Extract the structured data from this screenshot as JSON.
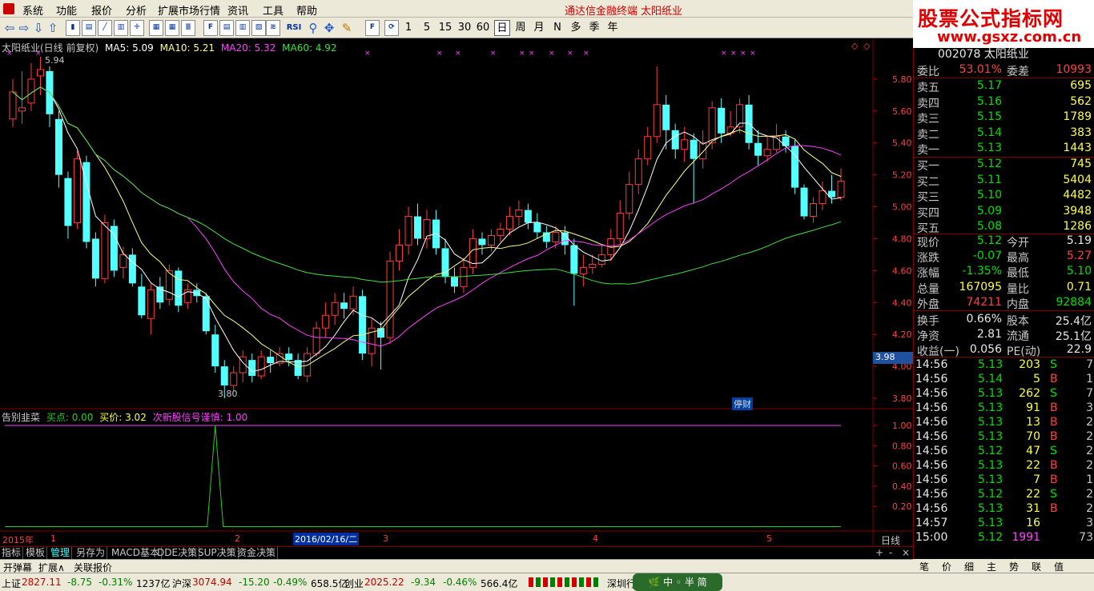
{
  "menu": {
    "items": [
      "系统",
      "功能",
      "报价",
      "分析",
      "扩展市场行情",
      "资讯",
      "工具",
      "帮助"
    ],
    "promo1": "通达信金融终端",
    "promo2": "太阳纸业"
  },
  "watermark": {
    "line1": "股票公式指标网",
    "line2": "www.gsxz.com.cn"
  },
  "toolbar": {
    "box_icons": [
      "RSI"
    ],
    "periods": [
      "1",
      "5",
      "15",
      "30",
      "60",
      "日",
      "周",
      "月",
      "N",
      "多",
      "季",
      "年"
    ],
    "active_period": "日"
  },
  "chart_header": {
    "title": "太阳纸业(日线 前复权)",
    "ma5": "MA5: 5.09",
    "ma10": "MA10: 5.21",
    "ma20": "MA20: 5.32",
    "ma60": "MA60: 4.92",
    "high_mark": "5.94",
    "low_mark": "3.80",
    "cursor_price": "3.98",
    "badge": "停财"
  },
  "indicator_header": {
    "name": "告别韭菜",
    "buy_point": "买点: 0.00",
    "buy_price": "买价: 3.02",
    "signal": "次新股信号谨慎: 1.00"
  },
  "x_axis": {
    "labels": [
      "2015年",
      "1",
      "2016/02/16/二",
      "3",
      "4",
      "5"
    ],
    "period_label": "日线"
  },
  "chart_data": [
    {
      "type": "candlestick",
      "title": "太阳纸业(日线 前复权)",
      "y_ticks": [
        5.8,
        5.6,
        5.4,
        5.2,
        5.0,
        4.8,
        4.6,
        4.4,
        4.2,
        4.0,
        3.8
      ],
      "ylim": [
        3.76,
        5.98
      ],
      "candles": [
        [
          5.55,
          5.72,
          5.8,
          5.5
        ],
        [
          5.6,
          5.62,
          5.85,
          5.52
        ],
        [
          5.65,
          5.8,
          5.9,
          5.6
        ],
        [
          5.82,
          5.86,
          5.94,
          5.7
        ],
        [
          5.85,
          5.58,
          5.88,
          5.5
        ],
        [
          5.55,
          5.2,
          5.6,
          5.12
        ],
        [
          5.18,
          4.88,
          5.22,
          4.8
        ],
        [
          4.9,
          5.3,
          5.35,
          4.86
        ],
        [
          5.28,
          4.78,
          5.32,
          4.74
        ],
        [
          4.8,
          4.55,
          4.84,
          4.5
        ],
        [
          4.55,
          4.9,
          4.95,
          4.52
        ],
        [
          4.88,
          4.6,
          4.92,
          4.56
        ],
        [
          4.62,
          4.7,
          4.75,
          4.55
        ],
        [
          4.7,
          4.52,
          4.74,
          4.5
        ],
        [
          4.5,
          4.32,
          4.58,
          4.3
        ],
        [
          4.3,
          4.48,
          4.52,
          4.2
        ],
        [
          4.5,
          4.4,
          4.56,
          4.36
        ],
        [
          4.42,
          4.6,
          4.64,
          4.38
        ],
        [
          4.6,
          4.38,
          4.62,
          4.34
        ],
        [
          4.4,
          4.48,
          4.52,
          4.36
        ],
        [
          4.48,
          4.44,
          4.52,
          4.4
        ],
        [
          4.44,
          4.22,
          4.46,
          4.2
        ],
        [
          4.2,
          4.0,
          4.26,
          3.96
        ],
        [
          4.0,
          3.88,
          4.04,
          3.8
        ],
        [
          3.88,
          3.96,
          4.0,
          3.84
        ],
        [
          3.96,
          4.06,
          4.1,
          3.9
        ],
        [
          4.04,
          3.94,
          4.08,
          3.9
        ],
        [
          3.94,
          4.06,
          4.1,
          3.92
        ],
        [
          4.06,
          4.02,
          4.1,
          3.96
        ],
        [
          4.02,
          4.08,
          4.12,
          4.0
        ],
        [
          4.08,
          4.04,
          4.12,
          4.0
        ],
        [
          4.04,
          3.94,
          4.08,
          3.92
        ],
        [
          3.94,
          4.08,
          4.12,
          3.9
        ],
        [
          4.08,
          4.24,
          4.28,
          4.06
        ],
        [
          4.24,
          4.32,
          4.4,
          4.18
        ],
        [
          4.32,
          4.4,
          4.46,
          4.26
        ],
        [
          4.4,
          4.36,
          4.46,
          4.3
        ],
        [
          4.36,
          4.44,
          4.5,
          4.32
        ],
        [
          4.44,
          4.08,
          4.48,
          4.04
        ],
        [
          4.08,
          4.24,
          4.3,
          4.0
        ],
        [
          4.24,
          4.18,
          4.28,
          3.98
        ],
        [
          4.18,
          4.66,
          4.72,
          4.14
        ],
        [
          4.66,
          4.76,
          4.86,
          4.6
        ],
        [
          4.76,
          4.94,
          5.0,
          4.7
        ],
        [
          4.94,
          4.8,
          5.02,
          4.76
        ],
        [
          4.8,
          4.92,
          4.98,
          4.74
        ],
        [
          4.92,
          4.74,
          4.98,
          4.7
        ],
        [
          4.74,
          4.56,
          4.8,
          4.52
        ],
        [
          4.56,
          4.5,
          4.62,
          4.46
        ],
        [
          4.5,
          4.62,
          4.68,
          4.46
        ],
        [
          4.62,
          4.8,
          4.86,
          4.58
        ],
        [
          4.8,
          4.76,
          4.84,
          4.7
        ],
        [
          4.76,
          4.82,
          4.86,
          4.72
        ],
        [
          4.82,
          4.86,
          4.9,
          4.78
        ],
        [
          4.86,
          4.94,
          5.0,
          4.82
        ],
        [
          4.94,
          4.98,
          5.04,
          4.88
        ],
        [
          4.98,
          4.9,
          5.02,
          4.86
        ],
        [
          4.9,
          4.84,
          4.96,
          4.8
        ],
        [
          4.84,
          4.78,
          4.88,
          4.74
        ],
        [
          4.78,
          4.84,
          4.88,
          4.74
        ],
        [
          4.84,
          4.76,
          4.88,
          4.7
        ],
        [
          4.76,
          4.58,
          4.8,
          4.38
        ],
        [
          4.58,
          4.62,
          4.7,
          4.5
        ],
        [
          4.62,
          4.64,
          4.7,
          4.58
        ],
        [
          4.64,
          4.7,
          4.76,
          4.62
        ],
        [
          4.7,
          4.8,
          4.86,
          4.66
        ],
        [
          4.8,
          4.96,
          5.04,
          4.76
        ],
        [
          4.96,
          5.14,
          5.22,
          4.92
        ],
        [
          5.14,
          5.3,
          5.36,
          5.08
        ],
        [
          5.3,
          5.44,
          5.5,
          5.26
        ],
        [
          5.44,
          5.64,
          5.88,
          5.4
        ],
        [
          5.64,
          5.48,
          5.7,
          5.36
        ],
        [
          5.48,
          5.36,
          5.52,
          5.3
        ],
        [
          5.36,
          5.42,
          5.5,
          5.28
        ],
        [
          5.42,
          5.3,
          5.46,
          5.02
        ],
        [
          5.3,
          5.4,
          5.48,
          5.24
        ],
        [
          5.4,
          5.62,
          5.66,
          5.36
        ],
        [
          5.62,
          5.46,
          5.68,
          5.4
        ],
        [
          5.46,
          5.5,
          5.6,
          5.44
        ],
        [
          5.5,
          5.64,
          5.68,
          5.46
        ],
        [
          5.64,
          5.4,
          5.7,
          5.36
        ],
        [
          5.4,
          5.32,
          5.48,
          5.26
        ],
        [
          5.32,
          5.36,
          5.44,
          5.28
        ],
        [
          5.36,
          5.44,
          5.52,
          5.34
        ],
        [
          5.44,
          5.38,
          5.48,
          5.34
        ],
        [
          5.38,
          5.12,
          5.42,
          5.08
        ],
        [
          5.12,
          4.94,
          5.14,
          4.92
        ],
        [
          4.94,
          5.02,
          5.06,
          4.9
        ],
        [
          5.02,
          5.1,
          5.16,
          4.98
        ],
        [
          5.1,
          5.06,
          5.2,
          5.02
        ],
        [
          5.06,
          5.16,
          5.24,
          5.04
        ]
      ],
      "series": [
        {
          "name": "MA5",
          "color": "#ffffff"
        },
        {
          "name": "MA10",
          "color": "#ffff80"
        },
        {
          "name": "MA20",
          "color": "#ff40ff"
        },
        {
          "name": "MA60",
          "color": "#40e040"
        }
      ]
    },
    {
      "type": "line",
      "title": "告别韭菜",
      "y_ticks": [
        1.0,
        0.8,
        0.6,
        0.4,
        0.2
      ],
      "ylim": [
        -0.02,
        1.04
      ],
      "series": [
        {
          "name": "次新股信号谨慎",
          "color": "#ff40ff",
          "values": [
            1.0,
            1.0
          ]
        },
        {
          "name": "买点",
          "color": "#20d020",
          "values": [
            0,
            0,
            1.0,
            0,
            0
          ]
        }
      ]
    }
  ],
  "quote": {
    "code_name": "002078  太阳纸业",
    "weibi_label": "委比",
    "weibi": "53.01%",
    "weicha_label": "委差",
    "weicha": "10993",
    "asks": [
      {
        "label": "卖五",
        "price": "5.17",
        "vol": "695"
      },
      {
        "label": "卖四",
        "price": "5.16",
        "vol": "562"
      },
      {
        "label": "卖三",
        "price": "5.15",
        "vol": "1789"
      },
      {
        "label": "卖二",
        "price": "5.14",
        "vol": "383"
      },
      {
        "label": "卖一",
        "price": "5.13",
        "vol": "1443"
      }
    ],
    "bids": [
      {
        "label": "买一",
        "price": "5.12",
        "vol": "745"
      },
      {
        "label": "买二",
        "price": "5.11",
        "vol": "5404"
      },
      {
        "label": "买三",
        "price": "5.10",
        "vol": "4482"
      },
      {
        "label": "买四",
        "price": "5.09",
        "vol": "3948"
      },
      {
        "label": "买五",
        "price": "5.08",
        "vol": "1286"
      }
    ],
    "stats": [
      {
        "l1": "现价",
        "v1": "5.12",
        "c1": "grn",
        "l2": "今开",
        "v2": "5.19",
        "c2": "wht"
      },
      {
        "l1": "涨跌",
        "v1": "-0.07",
        "c1": "grn",
        "l2": "最高",
        "v2": "5.27",
        "c2": "red"
      },
      {
        "l1": "涨幅",
        "v1": "-1.35%",
        "c1": "grn",
        "l2": "最低",
        "v2": "5.10",
        "c2": "grn"
      },
      {
        "l1": "总量",
        "v1": "167095",
        "c1": "yel",
        "l2": "量比",
        "v2": "0.71",
        "c2": "yel"
      },
      {
        "l1": "外盘",
        "v1": "74211",
        "c1": "red",
        "l2": "内盘",
        "v2": "92884",
        "c2": "grn"
      },
      {
        "l1": "换手",
        "v1": "0.66%",
        "c1": "wht",
        "l2": "股本",
        "v2": "25.4亿",
        "c2": "wht"
      },
      {
        "l1": "净资",
        "v1": "2.81",
        "c1": "wht",
        "l2": "流通",
        "v2": "25.1亿",
        "c2": "wht"
      },
      {
        "l1": "收益(一)",
        "v1": "0.056",
        "c1": "wht",
        "l2": "PE(动)",
        "v2": "22.9",
        "c2": "wht"
      }
    ],
    "ticks": [
      {
        "t": "14:56",
        "p": "5.13",
        "v": "203",
        "s": "S",
        "n": "7"
      },
      {
        "t": "14:56",
        "p": "5.14",
        "v": "5",
        "s": "B",
        "n": "1"
      },
      {
        "t": "14:56",
        "p": "5.13",
        "v": "262",
        "s": "S",
        "n": "7"
      },
      {
        "t": "14:56",
        "p": "5.13",
        "v": "91",
        "s": "B",
        "n": "3"
      },
      {
        "t": "14:56",
        "p": "5.13",
        "v": "13",
        "s": "B",
        "n": "2"
      },
      {
        "t": "14:56",
        "p": "5.13",
        "v": "70",
        "s": "B",
        "n": "2"
      },
      {
        "t": "14:56",
        "p": "5.12",
        "v": "47",
        "s": "S",
        "n": "2"
      },
      {
        "t": "14:56",
        "p": "5.13",
        "v": "22",
        "s": "B",
        "n": "2"
      },
      {
        "t": "14:56",
        "p": "5.13",
        "v": "7",
        "s": "B",
        "n": "1"
      },
      {
        "t": "14:56",
        "p": "5.12",
        "v": "22",
        "s": "S",
        "n": "2"
      },
      {
        "t": "14:56",
        "p": "5.13",
        "v": "31",
        "s": "B",
        "n": "2"
      },
      {
        "t": "14:57",
        "p": "5.13",
        "v": "16",
        "s": "",
        "n": "3"
      },
      {
        "t": "15:00",
        "p": "5.12",
        "v": "1991",
        "s": "",
        "n": "73"
      }
    ]
  },
  "bottom_tabs": [
    "指标",
    "模板",
    "管理",
    "另存为",
    "MACD基本",
    "DDE决策",
    "SUP决策",
    "资金决策"
  ],
  "bottom_tabs2": [
    "开弹幕",
    "扩展∧",
    "关联报价"
  ],
  "rp_tabs": [
    "笔",
    "价",
    "细",
    "主",
    "势",
    "联",
    "值"
  ],
  "status": {
    "sh_label": "上证",
    "sh_val": "2827.11",
    "sh_chg": "-8.75",
    "sh_pct": "-0.31%",
    "sh_amt": "1237亿",
    "sz_label": "沪深",
    "sz_val": "3074.94",
    "sz_chg": "-15.20",
    "sz_pct": "-0.49%",
    "sz_amt": "658.5亿",
    "cy_label": "创业",
    "cy_val": "2025.22",
    "cy_chg": "-9.34",
    "cy_pct": "-0.46%",
    "cy_amt": "566.4亿",
    "region": "深圳行"
  }
}
